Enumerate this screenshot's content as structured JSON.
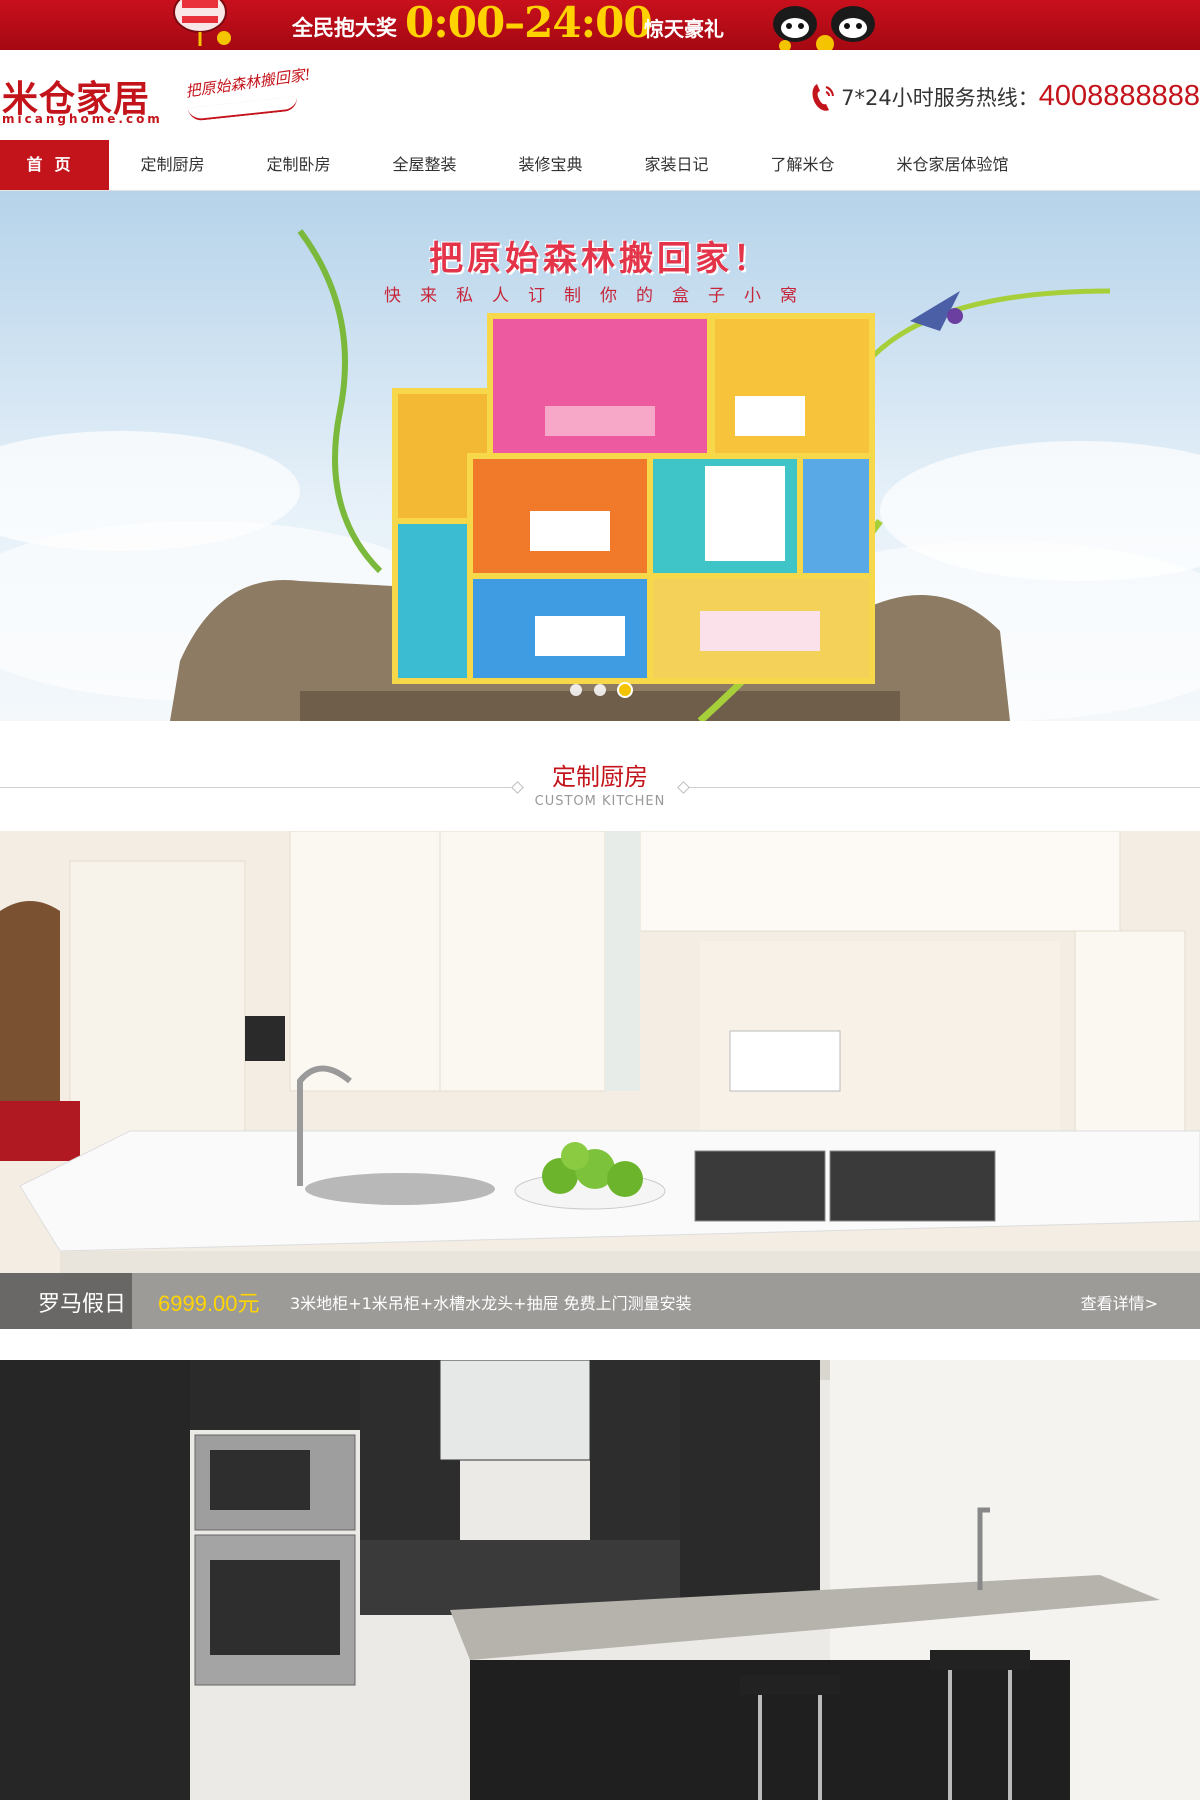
{
  "promo": {
    "text_left": "全民抱大奖",
    "time": "0:00–24:00",
    "text_right": "惊天豪礼"
  },
  "header": {
    "logo_cn": "米仓家居",
    "logo_en": "micanghome.com",
    "slogan": "把原始森林搬回家!",
    "hotline_label": "7*24小时服务热线：",
    "hotline_number": "4008888888"
  },
  "nav": {
    "items": [
      {
        "label": "首页"
      },
      {
        "label": "定制厨房"
      },
      {
        "label": "定制卧房"
      },
      {
        "label": "全屋整装"
      },
      {
        "label": "装修宝典"
      },
      {
        "label": "家装日记"
      },
      {
        "label": "了解米仓"
      },
      {
        "label": "米仓家居体验馆"
      }
    ],
    "active_index": 0
  },
  "hero": {
    "title": "把原始森林搬回家！",
    "subtitle": "快来私人订制你的盒子小窝",
    "slide_count": 3,
    "active_slide": 3
  },
  "section": {
    "title_cn": "定制厨房",
    "title_en": "CUSTOM KITCHEN"
  },
  "products": [
    {
      "name": "罗马假日",
      "price": "6999.00元",
      "desc": "3米地柜+1米吊柜+水槽水龙头+抽屉 免费上门测量安装",
      "more": "查看详情>"
    }
  ],
  "colors": {
    "brand_red": "#c4141b",
    "price_yellow": "#ffd400",
    "promo_yellow": "#ffd200"
  }
}
